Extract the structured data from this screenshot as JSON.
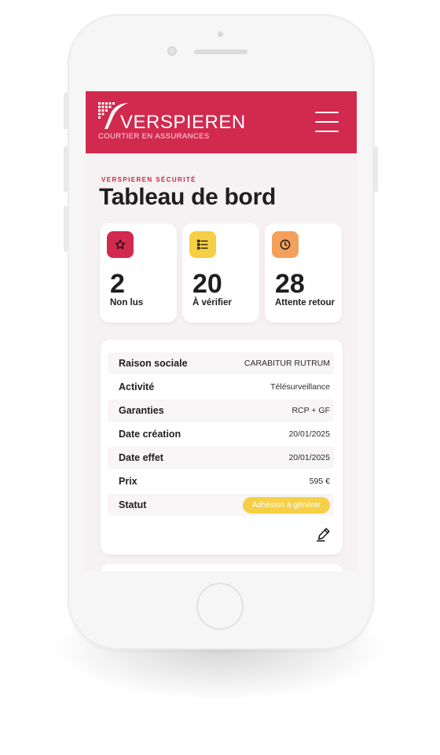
{
  "header": {
    "brand_name": "VERSPIEREN",
    "brand_tagline": "COURTIER EN ASSURANCES",
    "menu_icon": "hamburger-menu-icon"
  },
  "page": {
    "eyebrow": "VERSPIEREN SÉCURITÉ",
    "title": "Tableau de bord"
  },
  "stats": [
    {
      "value": "2",
      "label": "Non lus",
      "icon": "star-icon",
      "color": "#d2294e"
    },
    {
      "value": "20",
      "label": "À vérifier",
      "icon": "checklist-icon",
      "color": "#f5cf45"
    },
    {
      "value": "28",
      "label": "Attente retour",
      "icon": "clock-icon",
      "color": "#f3a05c"
    }
  ],
  "details": {
    "rows": [
      {
        "label": "Raison sociale",
        "value": "CARABITUR RUTRUM"
      },
      {
        "label": "Activité",
        "value": "Télésurveillance"
      },
      {
        "label": "Garanties",
        "value": "RCP + GF"
      },
      {
        "label": "Date création",
        "value": "20/01/2025"
      },
      {
        "label": "Date effet",
        "value": "20/01/2025"
      },
      {
        "label": "Prix",
        "value": "595 €"
      }
    ],
    "status_label": "Statut",
    "status_value": "Adhésion à générer",
    "status_color": "#f5cf45",
    "edit_icon": "pencil-icon"
  },
  "colors": {
    "brand": "#d2294e",
    "text": "#1f1f1f",
    "background": "#f6f1f2"
  }
}
